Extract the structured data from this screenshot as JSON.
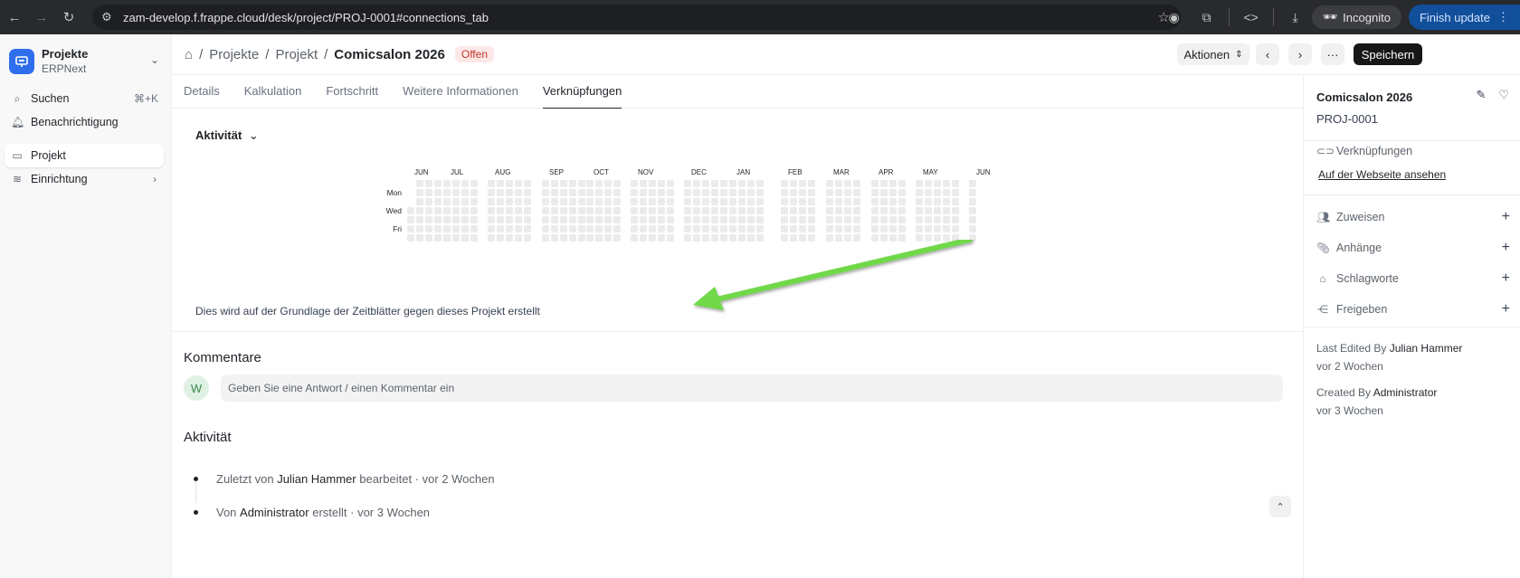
{
  "browser": {
    "url": "zam-develop.f.frappe.cloud/desk/project/PROJ-0001#connections_tab",
    "incognito_label": "Incognito",
    "finish_update_label": "Finish update"
  },
  "sidebar": {
    "app_name": "Projekte",
    "app_sub": "ERPNext",
    "search_label": "Suchen",
    "search_shortcut": "⌘+K",
    "notifications_label": "Benachrichtigung",
    "items": [
      {
        "label": "Projekt",
        "active": true
      },
      {
        "label": "Einrichtung",
        "active": false
      }
    ]
  },
  "header": {
    "breadcrumbs": [
      "Projekte",
      "Projekt"
    ],
    "current": "Comicsalon 2026",
    "status": "Offen",
    "actions_label": "Aktionen",
    "save_label": "Speichern"
  },
  "tabs": [
    "Details",
    "Kalkulation",
    "Fortschritt",
    "Weitere Informationen",
    "Verknüpfungen"
  ],
  "active_tab": "Verknüpfungen",
  "connections": {
    "activity_label": "Aktivität",
    "heatmap": {
      "months": [
        "JUN",
        "JUL",
        "AUG",
        "SEP",
        "OCT",
        "NOV",
        "DEC",
        "JAN",
        "FEB",
        "MAR",
        "APR",
        "MAY",
        "JUN"
      ],
      "day_labels": [
        "Mon",
        "Wed",
        "Fri"
      ],
      "cell_color": "#ebebeb"
    },
    "basis_text": "Dies wird auf der Grundlage der Zeitblätter gegen dieses Projekt erstellt",
    "arrow_color": "#6fd84a"
  },
  "comments": {
    "title": "Kommentare",
    "avatar_initial": "W",
    "placeholder": "Geben Sie eine Antwort / einen Kommentar ein"
  },
  "activity": {
    "title": "Aktivität",
    "items": [
      {
        "prefix": "Zuletzt von ",
        "user": "Julian Hammer",
        "suffix": " bearbeitet · vor 2 Wochen"
      },
      {
        "prefix": "Von ",
        "user": "Administrator",
        "suffix": " erstellt · vor 3 Wochen"
      }
    ]
  },
  "right_panel": {
    "title": "Comicsalon 2026",
    "id": "PROJ-0001",
    "connections_label": "Verknüpfungen",
    "website_link": "Auf der Webseite ansehen",
    "assign_label": "Zuweisen",
    "attachments_label": "Anhänge",
    "tags_label": "Schlagworte",
    "share_label": "Freigeben",
    "last_edited_prefix": "Last Edited By ",
    "last_edited_user": "Julian Hammer",
    "last_edited_time": "vor 2 Wochen",
    "created_prefix": "Created By ",
    "created_user": "Administrator",
    "created_time": "vor 3 Wochen"
  }
}
